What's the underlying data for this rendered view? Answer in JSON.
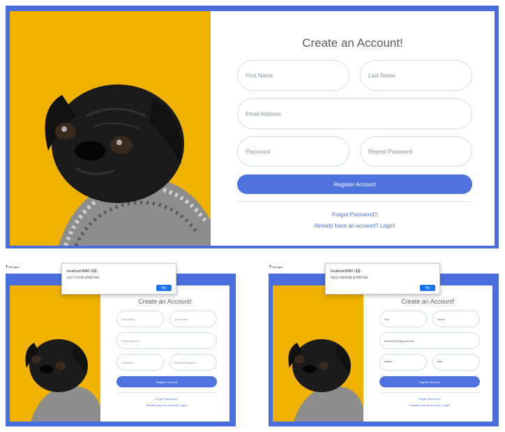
{
  "main": {
    "title": "Create an Account!",
    "first_name_placeholder": "First Name",
    "last_name_placeholder": "Last Name",
    "email_placeholder": "Email Address",
    "password_placeholder": "Password",
    "repeat_password_placeholder": "Repeat Password",
    "register_label": "Register Account",
    "forgot_label": "Forgot Password?",
    "login_label": "Already have an account? Login!"
  },
  "left_panel": {
    "tab_hint": "(tit) #get...",
    "dialog_title": "localhost:8080 내용:",
    "dialog_message": "성인이 된도록 입력해주세요.",
    "dialog_button": "확인",
    "title": "Create an Account!",
    "first_name_placeholder": "First Name",
    "last_name_placeholder": "Last Name",
    "email_placeholder": "Email Address",
    "password_placeholder": "Password",
    "repeat_password_placeholder": "Repeat Password",
    "register_label": "Register Account",
    "forgot_label": "Forgot Password?",
    "login_label": "Already have an account? Login!"
  },
  "right_panel": {
    "tab_hint": "(tit) #get...",
    "dialog_title": "localhost:8080 내용:",
    "dialog_message": "똑같은 비밀번호를 입력해주세요.",
    "dialog_button": "확인",
    "title": "Create an Account!",
    "first_name_value": "Seo",
    "last_name_value": "Siwon",
    "email_value": "tiswoni0930@gmail.com",
    "password_value": "••••••",
    "repeat_password_value": "••••",
    "register_label": "Register Account",
    "forgot_label": "Forgot Password?",
    "login_label": "Already have an account? Login!"
  },
  "colors": {
    "frame": "#4a6fdc",
    "accent": "#4e73df",
    "image_bg": "#efb200"
  },
  "icons": {
    "tab_icon": "T"
  }
}
